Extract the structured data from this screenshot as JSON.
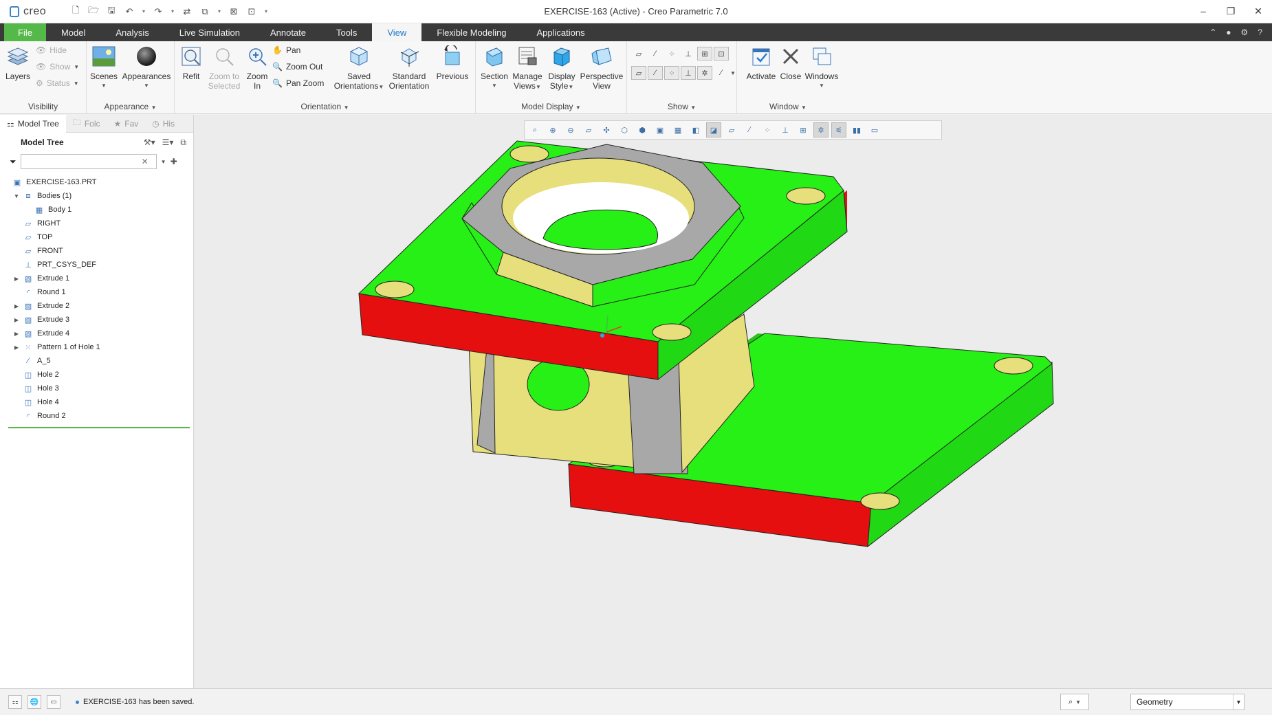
{
  "app": {
    "logo_text": "creo",
    "window_title": "EXERCISE-163 (Active) - Creo Parametric 7.0"
  },
  "window_controls": {
    "minimize": "–",
    "restore": "❐",
    "close": "✕"
  },
  "ribbon_tabs": [
    "File",
    "Model",
    "Analysis",
    "Live Simulation",
    "Annotate",
    "Tools",
    "View",
    "Flexible Modeling",
    "Applications"
  ],
  "active_tab": "View",
  "ribbon": {
    "visibility": {
      "label": "Visibility",
      "layers": "Layers",
      "hide": "Hide",
      "show": "Show",
      "status": "Status"
    },
    "appearance": {
      "label": "Appearance",
      "scenes": "Scenes",
      "appearances": "Appearances"
    },
    "orientation": {
      "label": "Orientation",
      "refit": "Refit",
      "zoom_to_selected": [
        "Zoom to",
        "Selected"
      ],
      "zoom_in": [
        "Zoom",
        "In"
      ],
      "pan": "Pan",
      "zoom_out": "Zoom Out",
      "pan_zoom": "Pan Zoom",
      "saved_orientations": [
        "Saved",
        "Orientations"
      ],
      "standard_orientation": [
        "Standard",
        "Orientation"
      ],
      "previous": "Previous"
    },
    "model_display": {
      "label": "Model Display",
      "section": "Section",
      "manage_views": [
        "Manage",
        "Views"
      ],
      "display_style": [
        "Display",
        "Style"
      ],
      "perspective_view": [
        "Perspective",
        "View"
      ]
    },
    "show": {
      "label": "Show"
    },
    "window": {
      "label": "Window",
      "activate": "Activate",
      "close": "Close",
      "windows": "Windows"
    }
  },
  "navigator": {
    "tabs": [
      "Model Tree",
      "Folc",
      "Fav",
      "His"
    ],
    "header": "Model Tree",
    "filter_placeholder": "",
    "items": [
      {
        "label": "EXERCISE-163.PRT",
        "level": 0,
        "expander": "",
        "icon": "part-icon"
      },
      {
        "label": "Bodies (1)",
        "level": 1,
        "expander": "▼",
        "icon": "bodies-icon"
      },
      {
        "label": "Body 1",
        "level": 2,
        "expander": "",
        "icon": "body-icon"
      },
      {
        "label": "RIGHT",
        "level": 1,
        "expander": "",
        "icon": "datum-plane-icon"
      },
      {
        "label": "TOP",
        "level": 1,
        "expander": "",
        "icon": "datum-plane-icon"
      },
      {
        "label": "FRONT",
        "level": 1,
        "expander": "",
        "icon": "datum-plane-icon"
      },
      {
        "label": "PRT_CSYS_DEF",
        "level": 1,
        "expander": "",
        "icon": "csys-icon"
      },
      {
        "label": "Extrude 1",
        "level": 1,
        "expander": "▶",
        "icon": "extrude-icon"
      },
      {
        "label": "Round 1",
        "level": 1,
        "expander": "",
        "icon": "round-icon"
      },
      {
        "label": "Extrude 2",
        "level": 1,
        "expander": "▶",
        "icon": "extrude-icon"
      },
      {
        "label": "Extrude 3",
        "level": 1,
        "expander": "▶",
        "icon": "extrude-icon"
      },
      {
        "label": "Extrude 4",
        "level": 1,
        "expander": "▶",
        "icon": "extrude-icon"
      },
      {
        "label": "Pattern 1 of Hole 1",
        "level": 1,
        "expander": "▶",
        "icon": "pattern-icon"
      },
      {
        "label": "A_5",
        "level": 1,
        "expander": "",
        "icon": "axis-icon"
      },
      {
        "label": "Hole 2",
        "level": 1,
        "expander": "",
        "icon": "hole-icon"
      },
      {
        "label": "Hole 3",
        "level": 1,
        "expander": "",
        "icon": "hole-icon"
      },
      {
        "label": "Hole 4",
        "level": 1,
        "expander": "",
        "icon": "hole-icon"
      },
      {
        "label": "Round 2",
        "level": 1,
        "expander": "",
        "icon": "round-icon"
      }
    ]
  },
  "graphics_toolbar": [
    "refit-icon",
    "zoom-in-icon",
    "zoom-out-icon",
    "repaint-icon",
    "spin-center-icon",
    "saved-orientations-icon",
    "view-manager-icon",
    "perspective-icon",
    "section-icon",
    "display-style-icon",
    "shading-icon",
    "datum-planes-icon",
    "datum-axes-icon",
    "datum-points-icon",
    "csys-display-icon",
    "annotations-icon",
    "spin-icon",
    "edge-display-icon",
    "pause-icon",
    "feature-icon"
  ],
  "status": {
    "message": "EXERCISE-163 has been saved.",
    "filter_value": "Geometry"
  },
  "colors": {
    "file_tab": "#54b948",
    "tab_bar": "#3a3a3a",
    "active_tab_text": "#1f7ac7",
    "model_green": "#27f016",
    "model_red": "#e60f0f",
    "model_yellow": "#e6df7c",
    "model_gray": "#a8a8a8",
    "viewport_bg": "#ececec"
  }
}
